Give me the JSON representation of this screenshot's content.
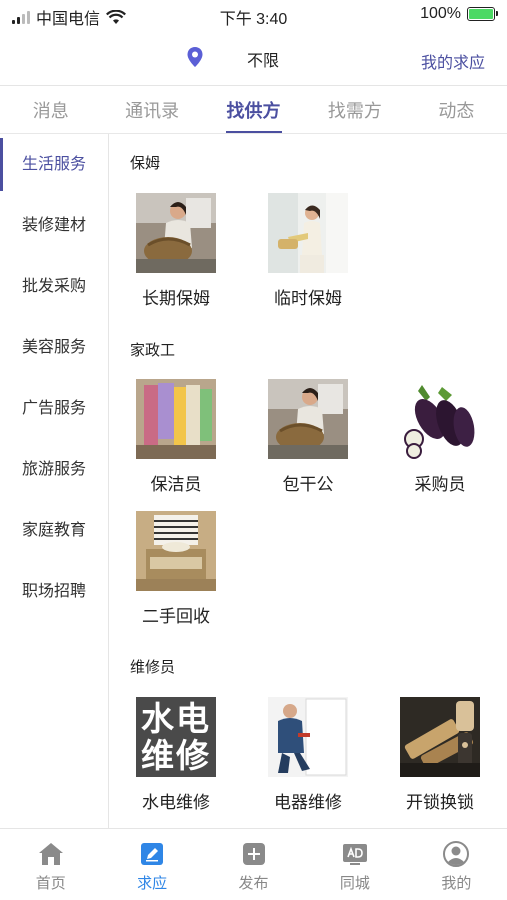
{
  "status_bar": {
    "carrier": "中国电信",
    "time": "下午 3:40",
    "battery": "100%",
    "battery_level": 1.0
  },
  "header": {
    "location": "不限",
    "my_responses": "我的求应"
  },
  "tabs": [
    {
      "label": "消息"
    },
    {
      "label": "通讯录"
    },
    {
      "label": "找供方"
    },
    {
      "label": "找需方"
    },
    {
      "label": "动态"
    }
  ],
  "sidebar": {
    "items": [
      {
        "label": "生活服务"
      },
      {
        "label": "装修建材"
      },
      {
        "label": "批发采购"
      },
      {
        "label": "美容服务"
      },
      {
        "label": "广告服务"
      },
      {
        "label": "旅游服务"
      },
      {
        "label": "家庭教育"
      },
      {
        "label": "职场招聘"
      }
    ]
  },
  "sections": [
    {
      "title": "保姆",
      "items": [
        {
          "label": "长期保姆"
        },
        {
          "label": "临时保姆"
        }
      ]
    },
    {
      "title": "家政工",
      "items": [
        {
          "label": "保洁员"
        },
        {
          "label": "包干公"
        },
        {
          "label": "采购员"
        },
        {
          "label": "二手回收"
        }
      ]
    },
    {
      "title": "维修员",
      "items": [
        {
          "label": "水电维修",
          "thumb_text": "水电维修"
        },
        {
          "label": "电器维修"
        },
        {
          "label": "开锁换锁"
        }
      ]
    }
  ],
  "bottom_nav": [
    {
      "label": "首页",
      "icon": "home-icon"
    },
    {
      "label": "求应",
      "icon": "edit-icon"
    },
    {
      "label": "发布",
      "icon": "plus-icon"
    },
    {
      "label": "同城",
      "icon": "ad-icon"
    },
    {
      "label": "我的",
      "icon": "user-icon"
    }
  ],
  "colors": {
    "accent": "#4b4fa0",
    "nav_active": "#2f86e6",
    "location_pin": "#5b5fd6",
    "battery_fill": "#4cd964"
  }
}
